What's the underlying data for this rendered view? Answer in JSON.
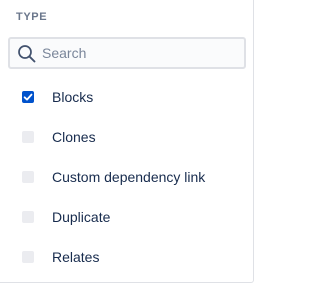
{
  "filter": {
    "title": "TYPE",
    "search": {
      "placeholder": "Search",
      "value": "",
      "icon": "search-icon"
    },
    "options": [
      {
        "label": "Blocks",
        "checked": true
      },
      {
        "label": "Clones",
        "checked": false
      },
      {
        "label": "Custom dependency link",
        "checked": false
      },
      {
        "label": "Duplicate",
        "checked": false
      },
      {
        "label": "Relates",
        "checked": false
      }
    ]
  },
  "colors": {
    "accent": "#0052cc",
    "title": "#6b778c",
    "text": "#172b4d",
    "placeholder": "#7a869a",
    "checkbox_unchecked": "#ebecf0",
    "border": "#dfe1e6"
  }
}
